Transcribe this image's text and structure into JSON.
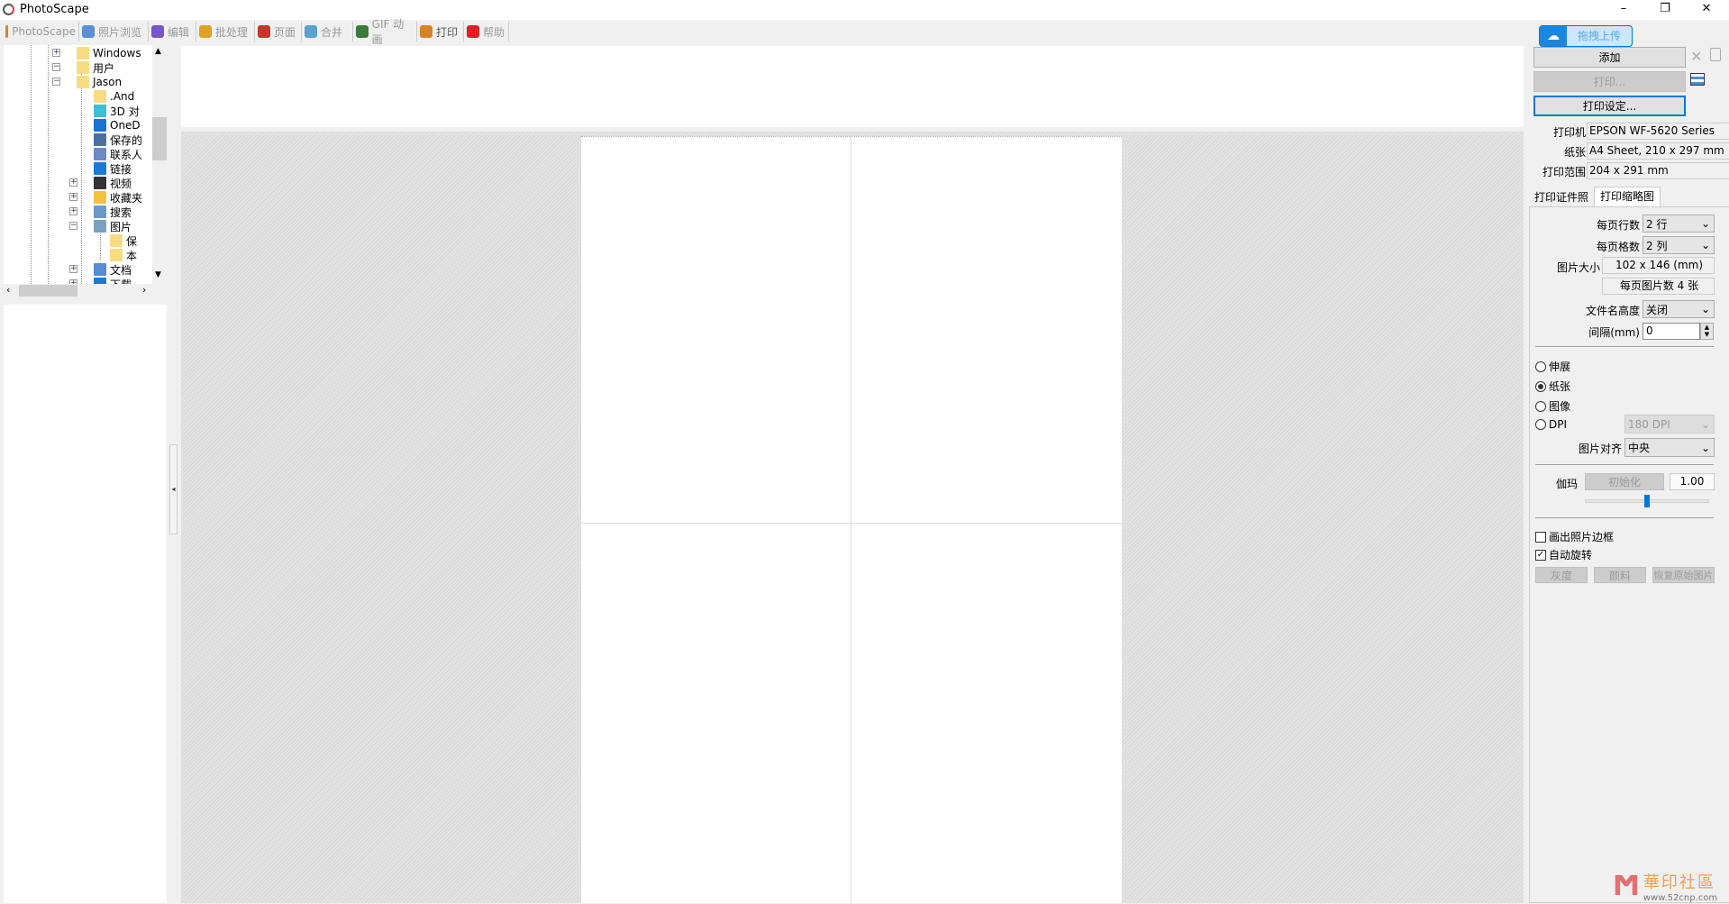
{
  "window": {
    "title": "PhotoScape",
    "minimize": "–",
    "maximize": "❐",
    "close": "✕"
  },
  "toolbar": {
    "tabs": [
      {
        "label": "PhotoScape",
        "color": "#d9822b"
      },
      {
        "label": "照片浏览",
        "color": "#5b8fd6"
      },
      {
        "label": "编辑",
        "color": "#7a55c7"
      },
      {
        "label": "批处理",
        "color": "#e0a020"
      },
      {
        "label": "页面",
        "color": "#c0392b"
      },
      {
        "label": "合并",
        "color": "#5aa0d0"
      },
      {
        "label": "GIF 动画",
        "color": "#3a7a3a"
      },
      {
        "label": "打印",
        "color": "#d9822b",
        "active": true
      },
      {
        "label": "帮助",
        "color": "#e02020"
      }
    ]
  },
  "tree": {
    "items": [
      {
        "label": "Windows",
        "toggle": "+",
        "icon": "folder-icon",
        "color": "#f8dc82"
      },
      {
        "label": "用户",
        "toggle": "−",
        "icon": "folder-icon",
        "color": "#f8dc82"
      },
      {
        "label": "Jason",
        "toggle": "−",
        "icon": "folder-icon",
        "color": "#f8dc82"
      },
      {
        "label": ".And",
        "icon": "folder-icon",
        "color": "#f8dc82"
      },
      {
        "label": "3D 对",
        "icon": "3d-objects-icon",
        "color": "#3cc0d8"
      },
      {
        "label": "OneD",
        "icon": "onedrive-icon",
        "color": "#1a73d0"
      },
      {
        "label": "保存的",
        "icon": "saved-games-icon",
        "color": "#4a6fa0"
      },
      {
        "label": "联系人",
        "icon": "contacts-icon",
        "color": "#6a8ac8"
      },
      {
        "label": "链接",
        "icon": "link-icon",
        "color": "#1a7ad8"
      },
      {
        "label": "视频",
        "toggle": "+",
        "icon": "video-icon",
        "color": "#333"
      },
      {
        "label": "收藏夹",
        "toggle": "+",
        "icon": "star-icon",
        "color": "#f4c040"
      },
      {
        "label": "搜索",
        "toggle": "+",
        "icon": "search-icon",
        "color": "#6a9ac8"
      },
      {
        "label": "图片",
        "toggle": "−",
        "icon": "pictures-icon",
        "color": "#7aa0c0"
      },
      {
        "label": "保",
        "icon": "folder-icon",
        "color": "#f8dc82"
      },
      {
        "label": "本",
        "icon": "folder-icon",
        "color": "#f8dc82"
      },
      {
        "label": "文档",
        "toggle": "+",
        "icon": "documents-icon",
        "color": "#5a8ad0"
      },
      {
        "label": "下载",
        "toggle": "+",
        "icon": "downloads-icon",
        "color": "#1a7ad8"
      }
    ]
  },
  "right": {
    "upload_label": "拖拽上传",
    "add_label": "添加",
    "print_label": "打印...",
    "print_setup_label": "打印设定...",
    "printer_label": "打印机",
    "printer_value": "EPSON WF-5620 Series",
    "paper_label": "纸张",
    "paper_value": "A4 Sheet, 210 x 297 mm",
    "range_label": "打印范围",
    "range_value": "204 x 291 mm",
    "tabs": [
      "打印证件照",
      "打印缩略图"
    ],
    "rows_label": "每页行数",
    "rows_value": "2 行",
    "cols_label": "每页格数",
    "cols_value": "2 列",
    "size_label": "图片大小",
    "size_value": "102 x 146 (mm)",
    "count_value": "每页图片数 4 张",
    "filename_label": "文件名高度",
    "filename_value": "关闭",
    "spacing_label": "间隔(mm)",
    "spacing_value": "0",
    "fit_options": [
      "伸展",
      "纸张",
      "图像",
      "DPI"
    ],
    "fit_selected": "纸张",
    "dpi_value": "180 DPI",
    "align_label": "图片对齐",
    "align_value": "中央",
    "gamma_label": "伽玛",
    "gamma_reset": "初始化",
    "gamma_value": "1.00",
    "gamma_slider": 0.5,
    "draw_border_label": "画出照片边框",
    "draw_border": false,
    "auto_rotate_label": "自动旋转",
    "auto_rotate": true,
    "gray_label": "灰度",
    "pigment_label": "颜料",
    "restore_label": "恢复原始图片",
    "accent": "#0078d7"
  },
  "watermark": {
    "text": "華印社區",
    "url": "www.52cnp.com"
  }
}
